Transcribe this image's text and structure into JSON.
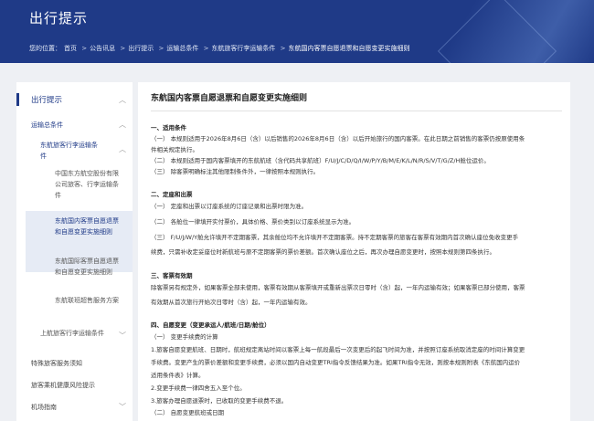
{
  "banner": {
    "title": "出行提示",
    "breadcrumb": [
      "您的位置：",
      "首页",
      "公告讯息",
      "出行提示",
      "运输总条件",
      "东航旅客行李运输条件",
      "东航国内客票自愿退票和自愿变更实施细则"
    ]
  },
  "sidebar": {
    "l1": "出行提示",
    "l2": "运输总条件",
    "l3": "东航旅客行李运输条件",
    "sub": [
      "中国东方航空股份有限公司旅客、行李运输条件",
      "东航国内客票自愿退票和自愿变更实施细则",
      "东航国际客票自愿退票和自愿变更实施细则",
      "东航联班超售服务方案"
    ],
    "l3b": "上航旅客行李运输条件",
    "others": [
      "特殊旅客服务须知",
      "旅客乘机健康风险提示",
      "机场指南"
    ]
  },
  "doc": {
    "title": "东航国内客票自愿退票和自愿变更实施细则",
    "lines": [
      "一、适用条件",
      "（一） 本规则适用于2026年8月6日（含）以后销售的2026年8月6日（含）以后开始旅行的国内客票。在此日期之前销售的客票仍按原使用条",
      "件相关规定执行。",
      "（二） 本规则适用于国内客票填开的东航航班（含代码共享航班）F/U/J/C/D/Q/I/W/P/Y/B/M/E/K/L/N/R/S/V/T/G/Z/H舱位运价。",
      "（三） 除客票明确标注其他限制条件外，一律按照本规则执行。",
      "二、定座和出票",
      "（一） 定座和出票以订座系统的订座记录和出票时限为准。",
      "（二） 各舱位一律填开实付票价，具体价格、票价类别以订座系统显示为准。",
      "（三） F/U/J/W/Y舱允许填开不定期客票，其余舱位均不允许填开不定期客票。持不定期客票的旅客在客票有效期内首次确认座位免收变更手",
      "续费，只需补收定妥座位时新航班与原不定期客票的票价差额。首次确认座位之后，再次办理自愿变更时，按照本规则第四条执行。",
      "三、客票有效期",
      "除客票另有规定外，如果客票全部未使用，客票有效期从客票填开或重新出票次日零时（含）起，一年内运输有效；如果客票已部分使用，客票",
      "有效期从首次旅行开始次日零时（含）起，一年内运输有效。",
      "四、自愿变更（变更承运人/航班/日期/舱位）",
      "（一） 变更手续费的计算",
      "1.旅客自愿变更航班、日期时，航班规定离站时间以客票上每一航段最后一次变更后的起飞时间为准，并按照订座系统取消定座的时间计算变更",
      "手续费。变更产生的票价差额和变更手续费，必须以国内自动变更TRI指令反馈结果为准。如果TRI指令无效，则按本规则附表《东航国内运价",
      "适用条件表》计算。",
      "2.变更手续费一律四舍五入至个位。",
      "3.旅客办理自愿退票时，已收取的变更手续费不退。",
      "（二） 自愿变更航班或日期"
    ]
  }
}
